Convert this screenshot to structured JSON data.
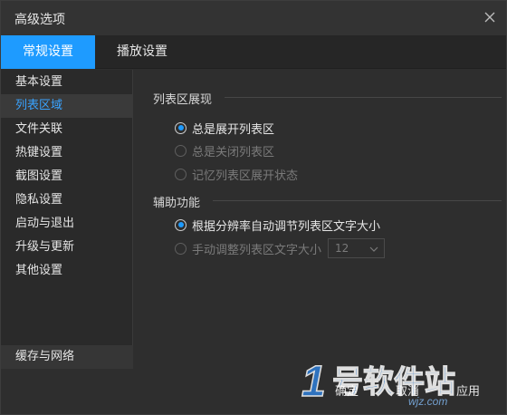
{
  "window": {
    "title": "高级选项"
  },
  "tabs": [
    {
      "label": "常规设置",
      "active": true
    },
    {
      "label": "播放设置",
      "active": false
    }
  ],
  "sidebar": {
    "items": [
      {
        "label": "基本设置",
        "active": false
      },
      {
        "label": "列表区域",
        "active": true
      },
      {
        "label": "文件关联",
        "active": false
      },
      {
        "label": "热键设置",
        "active": false
      },
      {
        "label": "截图设置",
        "active": false
      },
      {
        "label": "隐私设置",
        "active": false
      },
      {
        "label": "启动与退出",
        "active": false
      },
      {
        "label": "升级与更新",
        "active": false
      },
      {
        "label": "其他设置",
        "active": false
      }
    ],
    "bottom_item": "缓存与网络"
  },
  "content": {
    "list_display": {
      "title": "列表区展现",
      "options": [
        {
          "label": "总是展开列表区",
          "checked": true,
          "disabled": false
        },
        {
          "label": "总是关闭列表区",
          "checked": false,
          "disabled": true
        },
        {
          "label": "记忆列表区展开状态",
          "checked": false,
          "disabled": true
        }
      ]
    },
    "accessibility": {
      "title": "辅助功能",
      "options": [
        {
          "label": "根据分辨率自动调节列表区文字大小",
          "checked": true,
          "disabled": false
        },
        {
          "label": "手动调整列表区文字大小",
          "checked": false,
          "disabled": true
        }
      ],
      "font_size": {
        "value": "12"
      }
    }
  },
  "footer": {
    "ok_label": "确定",
    "cancel_label": "取消",
    "apply_label": "应用"
  },
  "watermark": {
    "text": "1号软件站",
    "url_text": "wjz.com"
  },
  "colors": {
    "accent": "#1e9bff",
    "active_text": "#39a3ff",
    "background": "#2e2e2e",
    "text": "#e6e6e6",
    "disabled_text": "#7a7a7a"
  },
  "icons": {
    "close": "close-icon",
    "radio_checked": "radio-checked-icon",
    "chevron": "chevron-down-icon"
  }
}
